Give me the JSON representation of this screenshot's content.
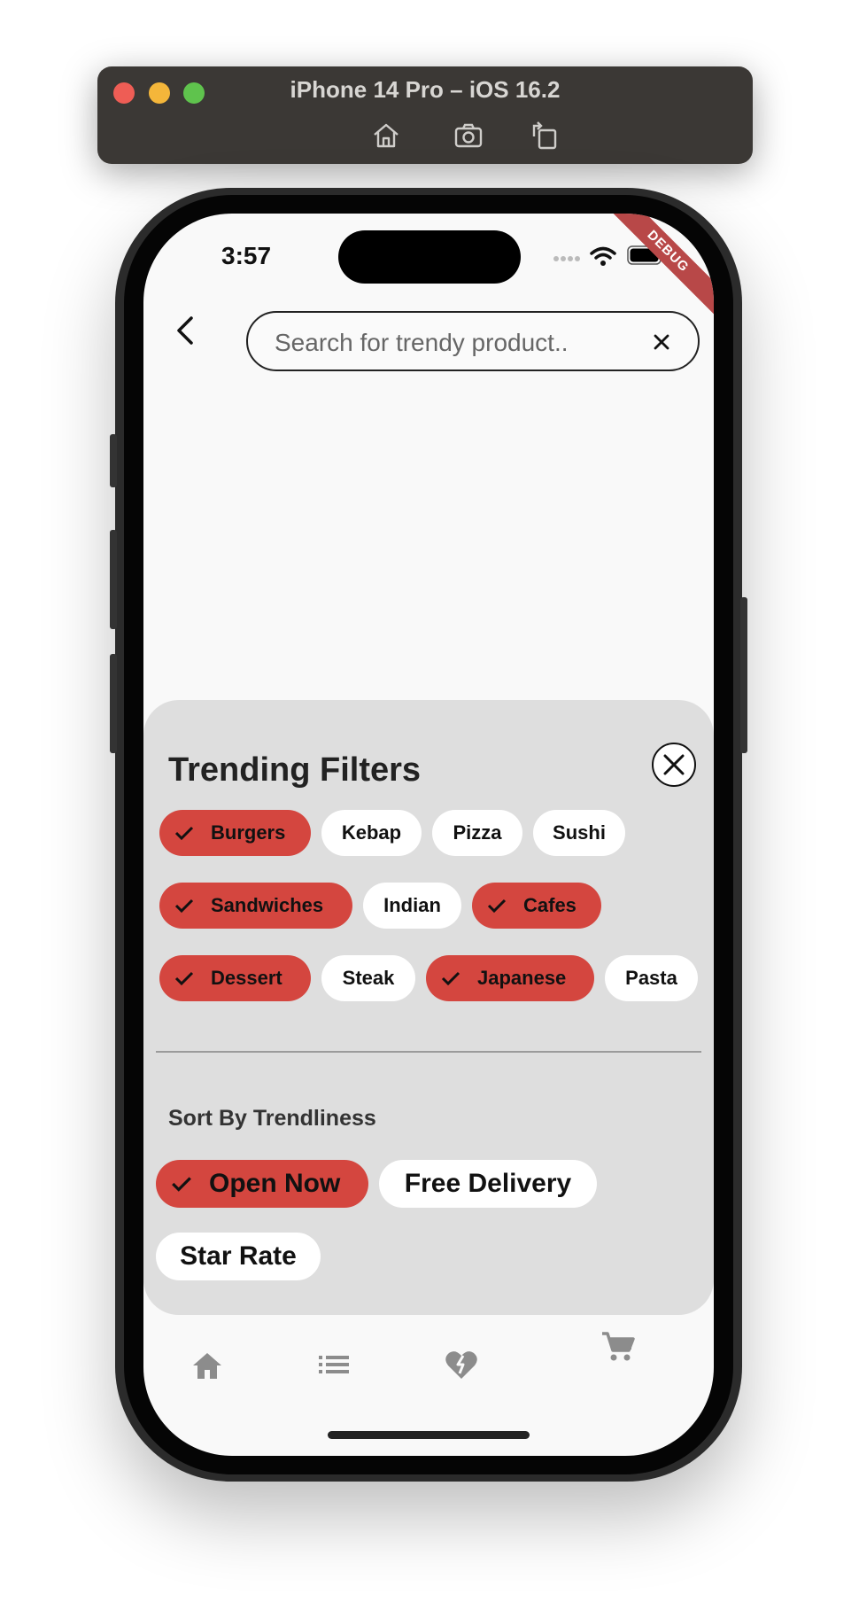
{
  "simulator": {
    "title": "iPhone 14 Pro – iOS 16.2",
    "tools": [
      "home-icon",
      "screenshot-icon",
      "rotate-icon"
    ]
  },
  "status_bar": {
    "time": "3:57",
    "debug_label": "DEBUG"
  },
  "search": {
    "placeholder": "Search for trendy product.."
  },
  "filters": {
    "title": "Trending Filters",
    "categories": [
      {
        "label": "Burgers",
        "selected": true
      },
      {
        "label": "Kebap",
        "selected": false
      },
      {
        "label": "Pizza",
        "selected": false
      },
      {
        "label": "Sushi",
        "selected": false
      },
      {
        "label": "Sandwiches",
        "selected": true
      },
      {
        "label": "Indian",
        "selected": false
      },
      {
        "label": "Cafes",
        "selected": true
      },
      {
        "label": "Dessert",
        "selected": true
      },
      {
        "label": "Steak",
        "selected": false
      },
      {
        "label": "Japanese",
        "selected": true
      },
      {
        "label": "Pasta",
        "selected": false
      }
    ],
    "sort_label": "Sort By Trendliness",
    "sort_options": [
      {
        "label": "Open Now",
        "selected": true
      },
      {
        "label": "Free Delivery",
        "selected": false
      },
      {
        "label": "Star Rate",
        "selected": false
      }
    ]
  },
  "bottom_nav": {
    "items": [
      "home-icon",
      "list-icon",
      "heart-broken-icon",
      "cart-icon"
    ]
  },
  "colors": {
    "selected_chip": "#d4463f",
    "sheet_bg": "#dedede"
  }
}
